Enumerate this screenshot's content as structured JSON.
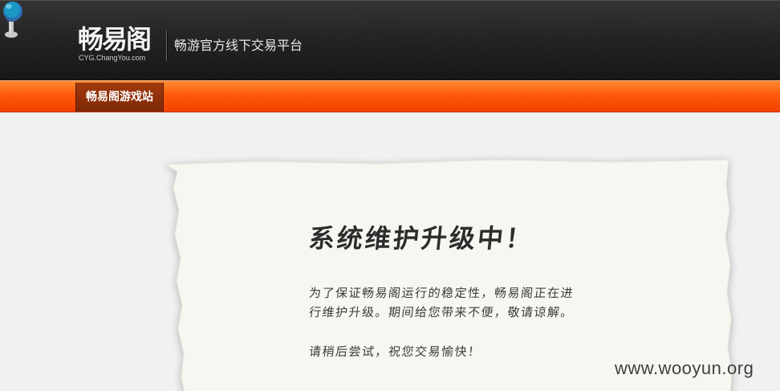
{
  "header": {
    "logo_main": "畅易阁",
    "logo_sub": "CYG.ChangYou.com",
    "tagline": "畅游官方线下交易平台"
  },
  "nav": {
    "items": [
      {
        "label": "畅易阁游戏站"
      }
    ]
  },
  "notice": {
    "title": "系统维护升级中！",
    "line1": "为了保证畅易阁运行的稳定性，畅易阁正在进",
    "line2": "行维护升级。期间给您带来不便，敬请谅解。",
    "line3": "请稍后尝试，祝您交易愉快！"
  },
  "watermark": "www.wooyun.org",
  "colors": {
    "header_dark": "#1c1c1c",
    "nav_orange": "#ff5a09",
    "nav_item_active": "#8a2f09",
    "paper": "#f7f7f1",
    "pin_head": "#1b97c6"
  },
  "icons": {
    "pin": "push-pin-icon"
  }
}
